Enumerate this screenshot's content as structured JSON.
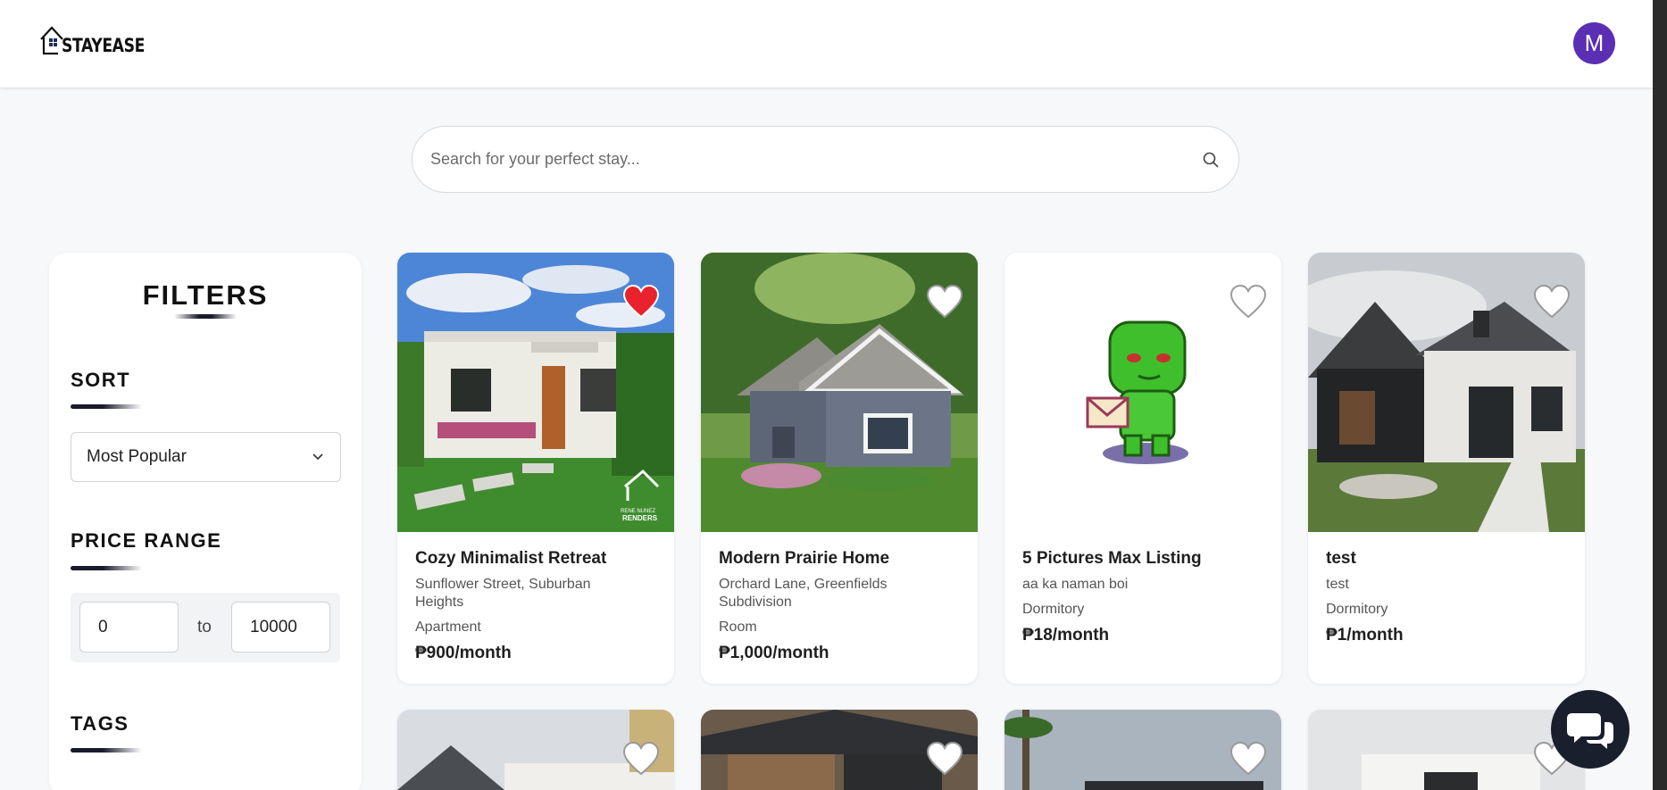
{
  "app": {
    "brand": "STAYEASE"
  },
  "header": {
    "avatar_initial": "M"
  },
  "search": {
    "placeholder": "Search for your perfect stay...",
    "value": ""
  },
  "filters": {
    "title": "FILTERS",
    "sort": {
      "title": "SORT",
      "selected": "Most Popular"
    },
    "price_range": {
      "title": "PRICE RANGE",
      "min": "0",
      "separator": "to",
      "max": "10000"
    },
    "tags": {
      "title": "TAGS"
    }
  },
  "listings": [
    {
      "title": "Cozy Minimalist Retreat",
      "address": "Sunflower Street, Suburban Heights",
      "type": "Apartment",
      "price": "₱900/month",
      "favorited": true
    },
    {
      "title": "Modern Prairie Home",
      "address": "Orchard Lane, Greenfields Subdivision",
      "type": "Room",
      "price": "₱1,000/month",
      "favorited": false
    },
    {
      "title": "5 Pictures Max Listing",
      "address": "aa ka naman boi",
      "type": "Dormitory",
      "price": "₱18/month",
      "favorited": false
    },
    {
      "title": "test",
      "address": "test",
      "type": "Dormitory",
      "price": "₱1/month",
      "favorited": false
    }
  ],
  "watermark": {
    "line1": "RENE NUNEZ",
    "line2": "RENDERS"
  },
  "colors": {
    "avatar": "#5b2fb3",
    "heart_active": "#e8232d",
    "chat_button": "#1a1f2e"
  },
  "icons": {
    "search": "search-icon",
    "chevron": "chevron-down-icon",
    "heart": "heart-icon",
    "chat": "chat-icon"
  }
}
